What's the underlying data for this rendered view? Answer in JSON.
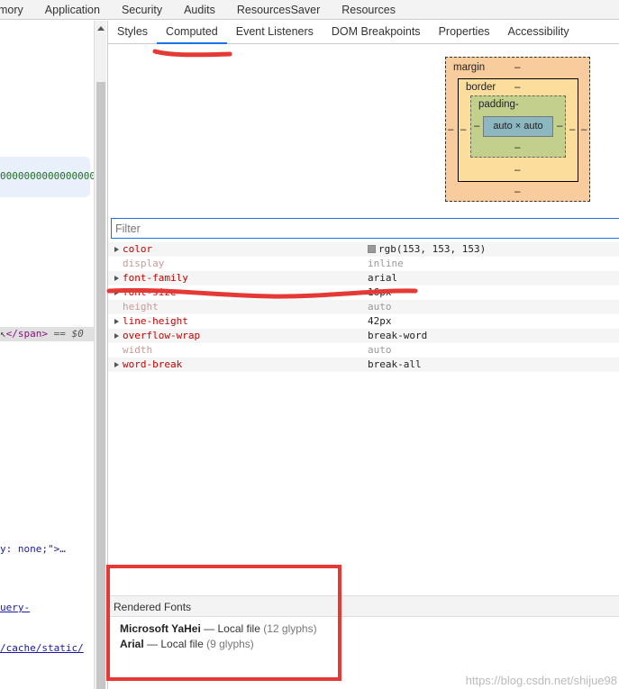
{
  "top_tabs": [
    "mory",
    "Application",
    "Security",
    "Audits",
    "ResourcesSaver",
    "Resources"
  ],
  "sub_tabs": {
    "items": [
      "Styles",
      "Computed",
      "Event Listeners",
      "DOM Breakpoints",
      "Properties",
      "Accessibility"
    ],
    "active": "Computed"
  },
  "dom": {
    "green_text": "0000000000000000",
    "span_text": "</span>",
    "span_eq": "== $0",
    "none_text": "y: none;\">…",
    "jq_text": "uery-",
    "cache_text": "/cache/static/"
  },
  "box_model": {
    "margin_label": "margin",
    "margin_top": "–",
    "margin_left": "–",
    "margin_right": "–",
    "margin_bottom": "–",
    "border_label": "border",
    "border_top": "–",
    "border_left": "–",
    "border_right": "–",
    "border_bottom": "–",
    "padding_label": "padding-",
    "padding_left": "–",
    "padding_right": "–",
    "padding_bottom": "–",
    "content": "auto × auto"
  },
  "filter": {
    "placeholder": "Filter"
  },
  "properties": [
    {
      "name": "color",
      "value": "rgb(153, 153, 153)",
      "expandable": true,
      "inherited": false,
      "swatch": "#999999"
    },
    {
      "name": "display",
      "value": "inline",
      "expandable": false,
      "inherited": true
    },
    {
      "name": "font-family",
      "value": "arial",
      "expandable": true,
      "inherited": false
    },
    {
      "name": "font-size",
      "value": "16px",
      "expandable": true,
      "inherited": false
    },
    {
      "name": "height",
      "value": "auto",
      "expandable": false,
      "inherited": true
    },
    {
      "name": "line-height",
      "value": "42px",
      "expandable": true,
      "inherited": false
    },
    {
      "name": "overflow-wrap",
      "value": "break-word",
      "expandable": true,
      "inherited": false
    },
    {
      "name": "width",
      "value": "auto",
      "expandable": false,
      "inherited": true
    },
    {
      "name": "word-break",
      "value": "break-all",
      "expandable": true,
      "inherited": false
    }
  ],
  "rendered_fonts": {
    "header": "Rendered Fonts",
    "items": [
      {
        "name": "Microsoft YaHei",
        "sep": "—",
        "source": "Local file",
        "count": "(12 glyphs)"
      },
      {
        "name": "Arial",
        "sep": "—",
        "source": "Local file",
        "count": "(9 glyphs)"
      }
    ]
  },
  "watermark": "https://blog.csdn.net/shijue98",
  "colors": {
    "annotation": "#e53935",
    "accent": "#1a73e8"
  }
}
